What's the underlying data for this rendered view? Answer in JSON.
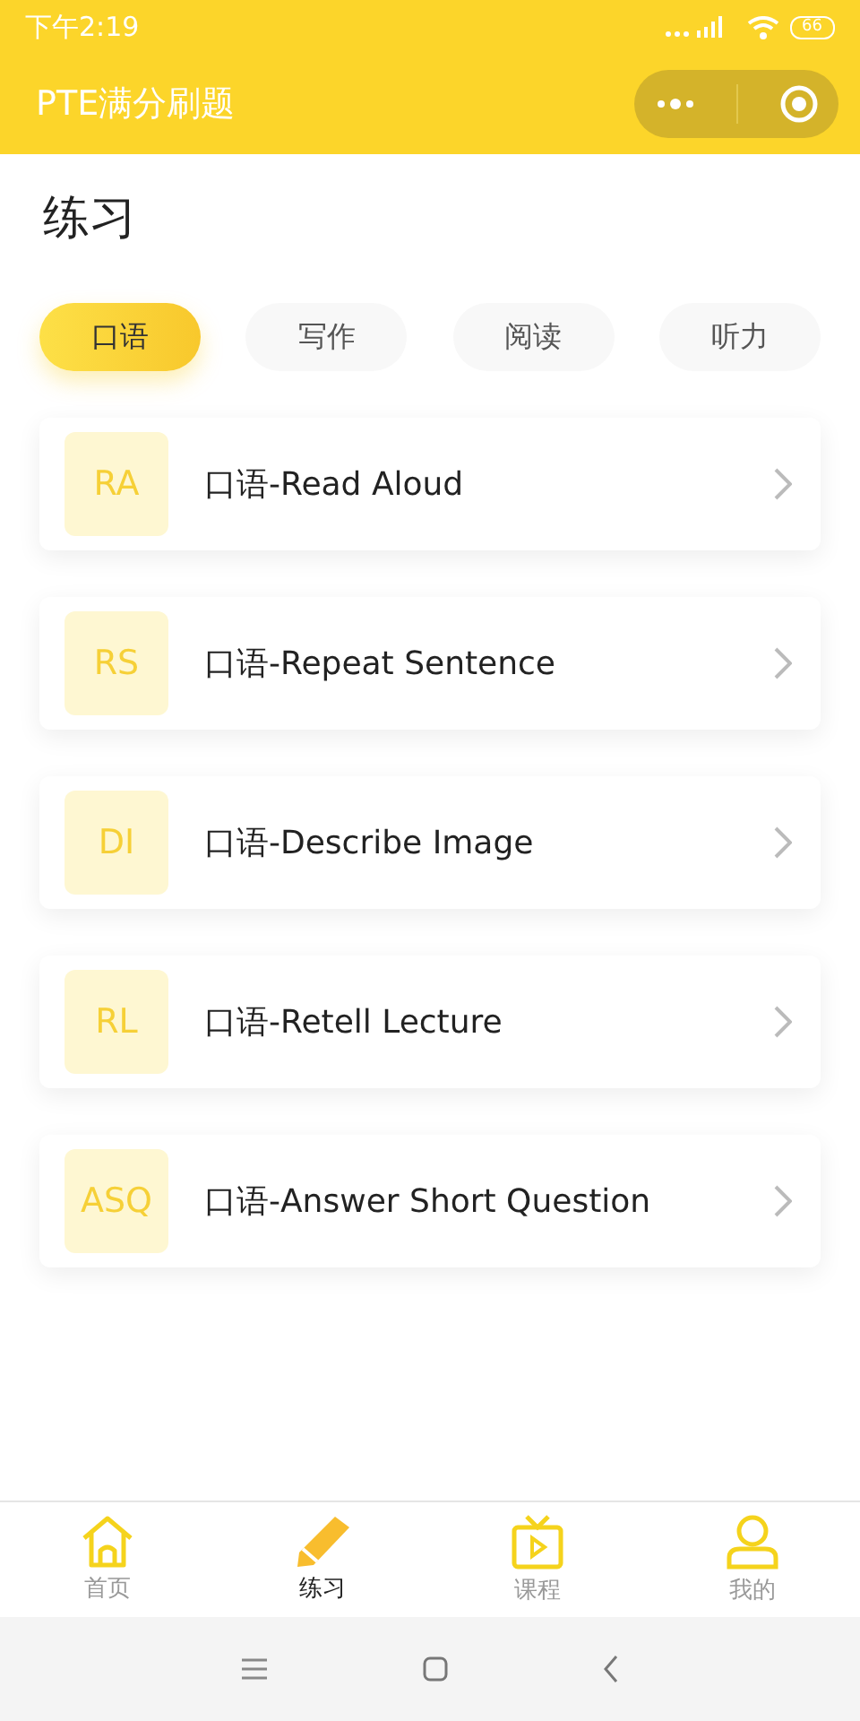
{
  "status_bar": {
    "time": "下午2:19",
    "battery": "66"
  },
  "nav_bar": {
    "title": "PTE满分刷题"
  },
  "page_title": "练习",
  "tabs": [
    {
      "label": "口语",
      "selected": true
    },
    {
      "label": "写作",
      "selected": false
    },
    {
      "label": "阅读",
      "selected": false
    },
    {
      "label": "听力",
      "selected": false
    }
  ],
  "items": [
    {
      "abbr": "RA",
      "title": "口语-Read Aloud"
    },
    {
      "abbr": "RS",
      "title": "口语-Repeat Sentence"
    },
    {
      "abbr": "DI",
      "title": "口语-Describe Image"
    },
    {
      "abbr": "RL",
      "title": "口语-Retell Lecture"
    },
    {
      "abbr": "ASQ",
      "title": "口语-Answer Short Question"
    }
  ],
  "bottom_tabs": [
    {
      "label": "首页",
      "selected": false
    },
    {
      "label": "练习",
      "selected": true
    },
    {
      "label": "课程",
      "selected": false
    },
    {
      "label": "我的",
      "selected": false
    }
  ]
}
